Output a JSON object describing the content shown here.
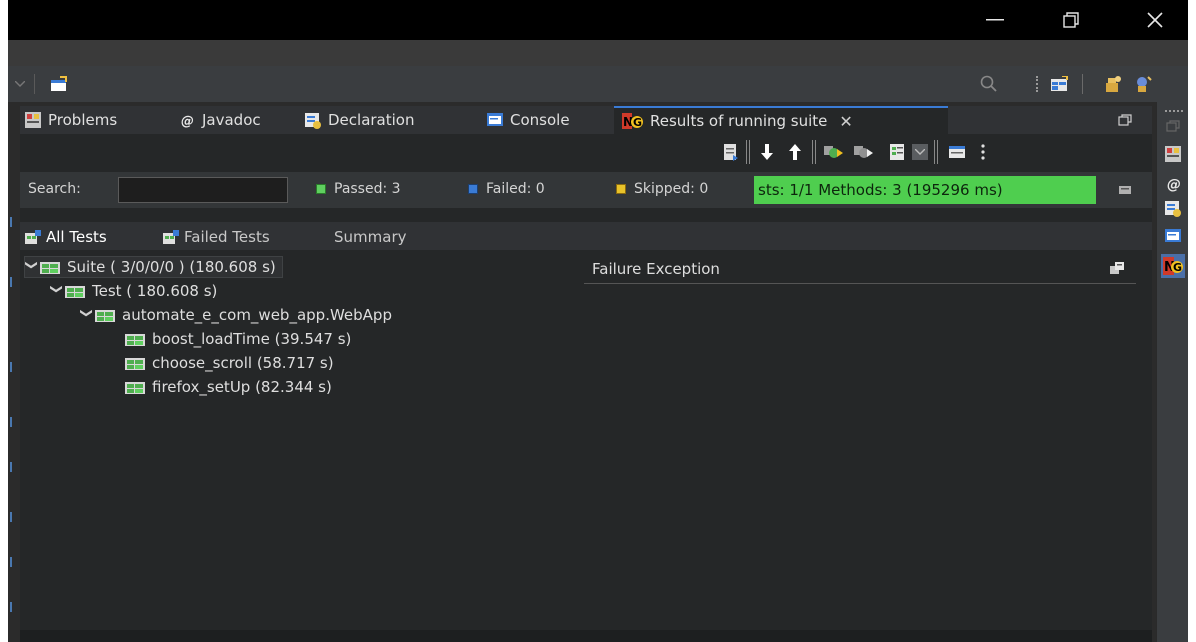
{
  "window": {
    "controls": {
      "minimize_icon": "minimize-icon",
      "maximize_icon": "restore-icon",
      "close_icon": "close-icon"
    }
  },
  "views": {
    "tabs": [
      {
        "label": "Problems",
        "icon": "problems-icon"
      },
      {
        "label": "Javadoc",
        "icon": "at-icon"
      },
      {
        "label": "Declaration",
        "icon": "declaration-icon"
      },
      {
        "label": "Console",
        "icon": "console-icon"
      },
      {
        "label": "Results of running suite",
        "icon": "testng-icon",
        "active": true
      }
    ]
  },
  "results": {
    "search_label": "Search:",
    "search_value": "",
    "passed": "Passed: 3",
    "failed": "Failed: 0",
    "skipped": "Skipped: 0",
    "progress_text": "sts: 1/1  Methods: 3 (195296 ms)",
    "progress_fraction": 1.0,
    "subtabs": [
      "All Tests",
      "Failed Tests",
      "Summary"
    ],
    "tree": {
      "suite": "Suite ( 3/0/0/0 ) (180.608 s)",
      "test": "Test ( 180.608 s)",
      "class": "automate_e_com_web_app.WebApp",
      "methods": [
        "boost_loadTime  (39.547 s)",
        "choose_scroll  (58.717 s)",
        "firefox_setUp  (82.344 s)"
      ]
    },
    "failure_header": "Failure Exception"
  },
  "colors": {
    "progress": "#4fce4f",
    "passed": "#5fcf5f",
    "failed": "#3a7bd5",
    "skipped": "#e8c22a",
    "active_tab_accent": "#3a7bd5"
  }
}
